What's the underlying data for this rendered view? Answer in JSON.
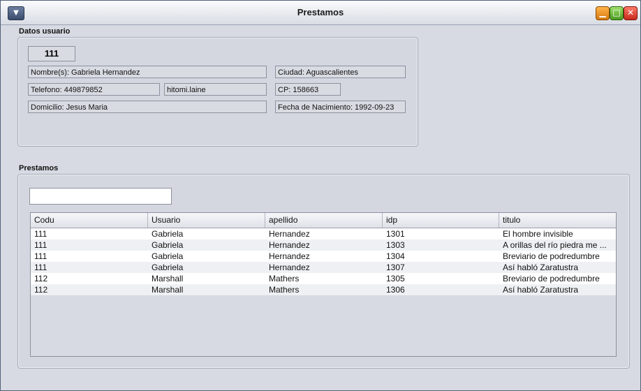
{
  "window": {
    "title": "Prestamos"
  },
  "datos_usuario": {
    "label": "Datos usuario",
    "id": "111",
    "nombre": "Nombre(s): Gabriela Hernandez",
    "telefono": "Telefono: 449879852",
    "usuario": "hitomi.laine",
    "domicilio": "Domicilio: Jesus Maria",
    "ciudad": "Ciudad: Aguascalientes",
    "cp": "CP: 158663",
    "fecha_nacimiento": "Fecha de Nacimiento: 1992-09-23"
  },
  "prestamos": {
    "label": "Prestamos",
    "search": {
      "value": "",
      "placeholder": ""
    },
    "columns": [
      "Codu",
      "Usuario",
      "apellido",
      "idp",
      "titulo"
    ],
    "rows": [
      [
        "111",
        "Gabriela",
        "Hernandez",
        "1301",
        "El hombre invisible"
      ],
      [
        "111",
        "Gabriela",
        "Hernandez",
        "1303",
        "A orillas del río piedra me ..."
      ],
      [
        "111",
        "Gabriela",
        "Hernandez",
        "1304",
        "Breviario de podredumbre"
      ],
      [
        "111",
        "Gabriela",
        "Hernandez",
        "1307",
        "Así habló Zaratustra"
      ],
      [
        "112",
        "Marshall",
        "Mathers",
        "1305",
        "Breviario de podredumbre"
      ],
      [
        "112",
        "Marshall",
        "Mathers",
        "1306",
        "Así habló Zaratustra"
      ]
    ]
  },
  "icons": {
    "menu": "chevron-down-icon",
    "minimize": "minimize-icon",
    "maximize": "maximize-icon",
    "close": "close-icon"
  }
}
